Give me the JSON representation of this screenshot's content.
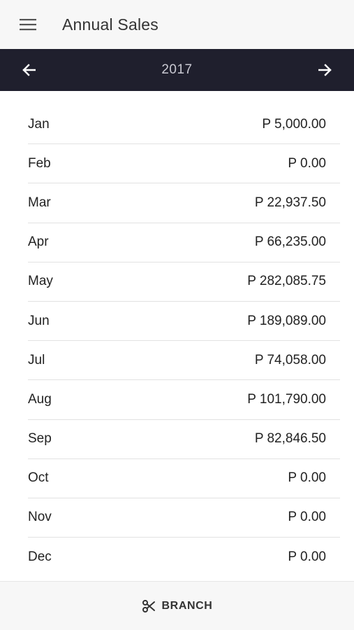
{
  "header": {
    "title": "Annual Sales",
    "menu_icon": "hamburger-menu-icon"
  },
  "year_nav": {
    "year": "2017",
    "prev_icon": "arrow-left-icon",
    "next_icon": "arrow-right-icon"
  },
  "sales": [
    {
      "month": "Jan",
      "amount": "P 5,000.00"
    },
    {
      "month": "Feb",
      "amount": "P 0.00"
    },
    {
      "month": "Mar",
      "amount": "P 22,937.50"
    },
    {
      "month": "Apr",
      "amount": "P 66,235.00"
    },
    {
      "month": "May",
      "amount": "P 282,085.75"
    },
    {
      "month": "Jun",
      "amount": "P 189,089.00"
    },
    {
      "month": "Jul",
      "amount": "P 74,058.00"
    },
    {
      "month": "Aug",
      "amount": "P 101,790.00"
    },
    {
      "month": "Sep",
      "amount": "P 82,846.50"
    },
    {
      "month": "Oct",
      "amount": "P 0.00"
    },
    {
      "month": "Nov",
      "amount": "P 0.00"
    },
    {
      "month": "Dec",
      "amount": "P 0.00"
    }
  ],
  "footer": {
    "branch_label": "BRANCH",
    "branch_icon": "scissors-icon"
  },
  "colors": {
    "year_bar_bg": "#1f1f2d",
    "appbar_bg": "#f7f7f7",
    "divider": "#e2e2e2"
  }
}
